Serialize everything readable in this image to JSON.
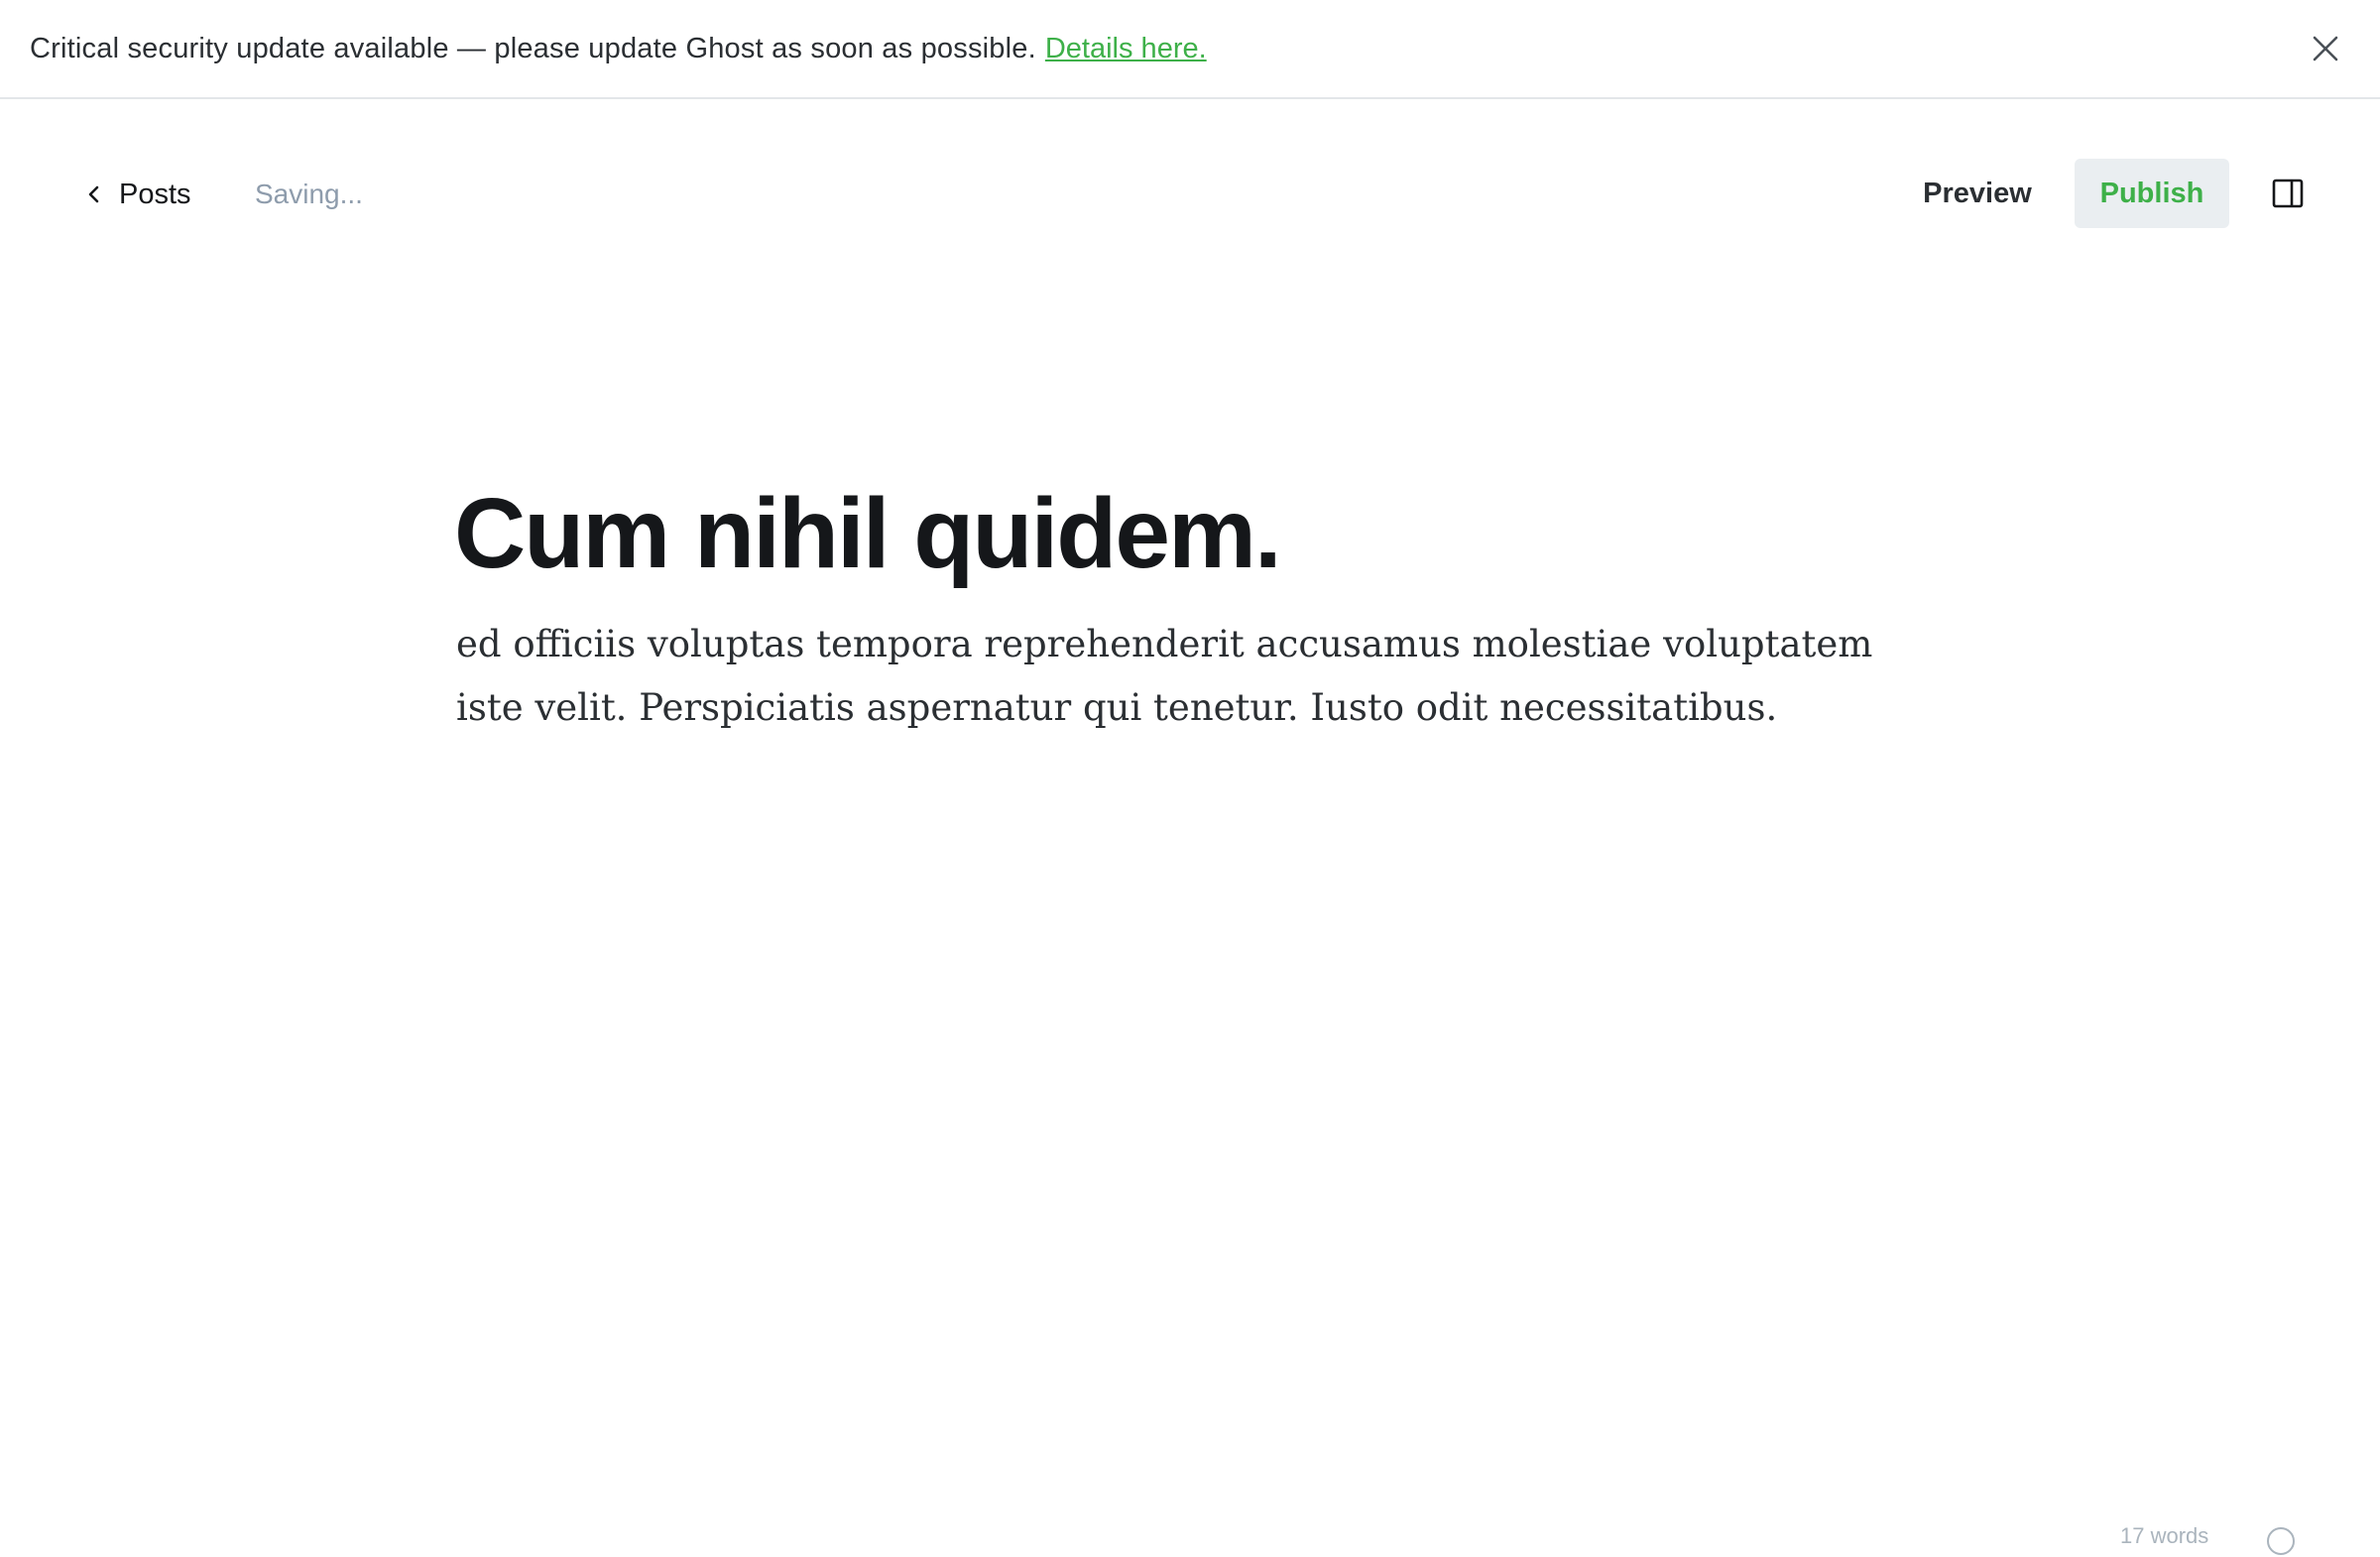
{
  "banner": {
    "message": "Critical security update available — please update Ghost as soon as possible.",
    "link_label": "Details here.",
    "close_icon": "close-icon"
  },
  "header": {
    "back_label": "Posts",
    "back_icon": "chevron-left-icon",
    "save_status": "Saving...",
    "preview_label": "Preview",
    "publish_label": "Publish",
    "sidebar_icon": "sidebar-toggle-icon"
  },
  "editor": {
    "title": "Cum nihil quidem.",
    "body": "ed officiis voluptas tempora reprehenderit accusamus molestiae voluptatem iste velit. Perspiciatis aspernatur qui tenetur. Iusto odit necessitatibus."
  },
  "footer": {
    "word_count": "17 words",
    "help_icon": "help-icon"
  },
  "colors": {
    "accent_green": "#3eb049",
    "text_dark": "#15171a",
    "muted": "#8e9cac",
    "button_bg": "#eaeef1",
    "divider": "#e3e6e9"
  }
}
